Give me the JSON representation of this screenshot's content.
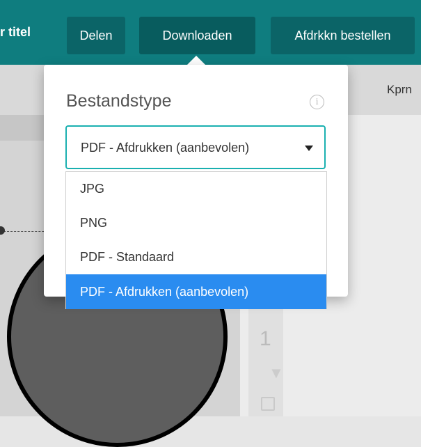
{
  "header": {
    "title_fragment": "r titel",
    "buttons": {
      "share": "Delen",
      "download": "Downloaden",
      "order": "Afdrkkn bestellen"
    }
  },
  "secondbar": {
    "item": "Kprn"
  },
  "canvas": {
    "page_number": "1"
  },
  "download_popover": {
    "title": "Bestandstype",
    "info_icon": "info-icon",
    "select": {
      "value": "PDF - Afdrukken (aanbevolen)",
      "options": [
        "JPG",
        "PNG",
        "PDF - Standaard",
        "PDF - Afdrukken (aanbevolen)"
      ],
      "selected_index": 3
    }
  },
  "colors": {
    "header": "#0f7d7f",
    "accent": "#1ab0b0",
    "selected": "#2a8cf0"
  }
}
